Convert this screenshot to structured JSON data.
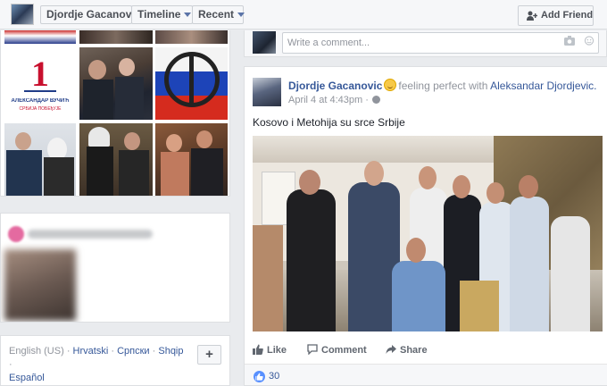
{
  "topbar": {
    "name": "Djordje Gacanovic",
    "timeline": "Timeline",
    "recent": "Recent",
    "add_friend": "Add Friend"
  },
  "comment_box": {
    "placeholder": "Write a comment..."
  },
  "post": {
    "author": "Djordje Gacanovic",
    "feeling": "feeling perfect with",
    "with": "Aleksandar Djordjevic.",
    "date": "April 4 at 4:43pm ·",
    "text": "Kosovo i Metohija su srce Srbije",
    "actions": {
      "like": "Like",
      "comment": "Comment",
      "share": "Share"
    },
    "like_count": "30"
  },
  "photos": {
    "vucic_caption": "АЛЕКСАНДАР ВУЧИЋ",
    "vucic_slogan": "СРБИЈА ПОБЕђУЈЕ",
    "vucic_number": "1"
  },
  "languages": {
    "english": "English (US)",
    "sep": "·",
    "hrvatski": "Hrvatski",
    "srpski": "Српски",
    "shqip": "Shqip",
    "espanol": "Español",
    "more": "+"
  },
  "colors": {
    "link": "#365899",
    "accent": "#4267b2",
    "like_blue": "#5890ff"
  }
}
